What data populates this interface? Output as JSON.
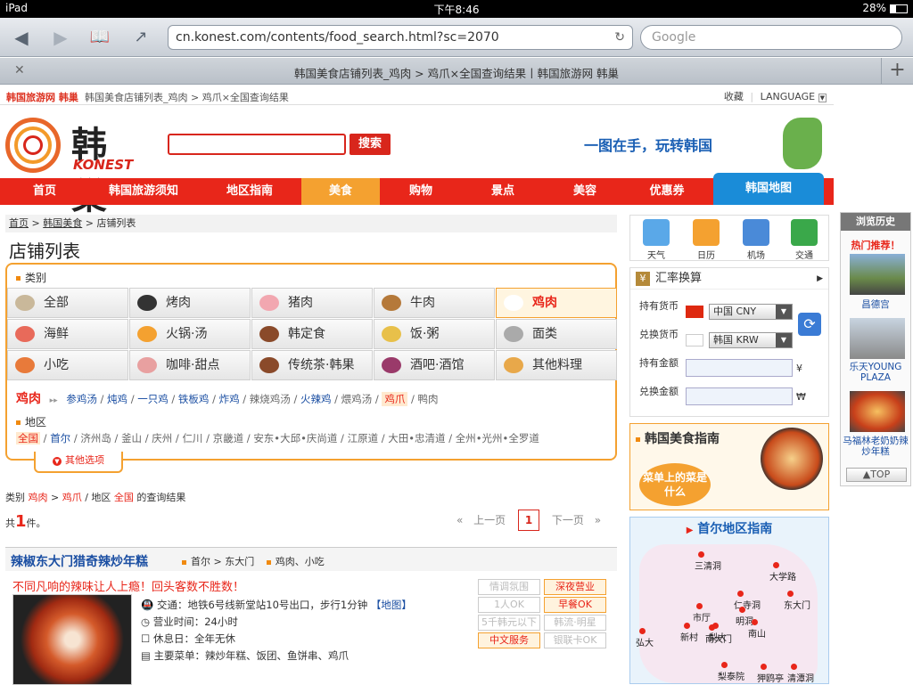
{
  "status": {
    "device": "iPad",
    "time": "下午8:46",
    "battery": "28%"
  },
  "browser": {
    "url": "cn.konest.com/contents/food_search.html?sc=2070",
    "search_placeholder": "Google",
    "tab_title": "韩国美食店铺列表_鸡肉 > 鸡爪×全国查询结果丨韩国旅游网 韩巢"
  },
  "topline": {
    "brand": "韩国旅游网 韩巢",
    "crumb": "韩国美食店铺列表_鸡肉 > 鸡爪×全国查询结果",
    "favorite": "收藏",
    "language": "LANGUAGE"
  },
  "logo": {
    "cn": "韩巢",
    "en": "KONEST"
  },
  "search": {
    "button": "搜索",
    "value": ""
  },
  "banner": {
    "text": "一图在手，玩转韩国"
  },
  "nav": [
    "首页",
    "韩国旅游须知",
    "地区指南",
    "美食",
    "购物",
    "景点",
    "美容",
    "优惠券",
    "韩国地图"
  ],
  "breadcrumb": {
    "home": "首页",
    "food": "韩国美食",
    "current": "店铺列表"
  },
  "page_title": "店铺列表",
  "category": {
    "label": "类别",
    "items": [
      {
        "label": "全部",
        "icon": "book-icon"
      },
      {
        "label": "烤肉",
        "icon": "grill-icon"
      },
      {
        "label": "猪肉",
        "icon": "pig-icon"
      },
      {
        "label": "牛肉",
        "icon": "cow-icon"
      },
      {
        "label": "鸡肉",
        "icon": "chicken-icon"
      },
      {
        "label": "海鲜",
        "icon": "crab-icon"
      },
      {
        "label": "火锅·汤",
        "icon": "hotpot-icon"
      },
      {
        "label": "韩定食",
        "icon": "set-meal-icon"
      },
      {
        "label": "饭·粥",
        "icon": "rice-icon"
      },
      {
        "label": "面类",
        "icon": "noodle-icon"
      },
      {
        "label": "小吃",
        "icon": "snack-icon"
      },
      {
        "label": "咖啡·甜点",
        "icon": "coffee-icon"
      },
      {
        "label": "传统茶·韩果",
        "icon": "tea-icon"
      },
      {
        "label": "酒吧·酒馆",
        "icon": "wine-icon"
      },
      {
        "label": "其他料理",
        "icon": "other-food-icon"
      }
    ],
    "sub_title": "鸡肉",
    "sub_items": [
      "参鸡汤",
      "炖鸡",
      "一只鸡",
      "铁板鸡",
      "炸鸡",
      "辣烧鸡汤",
      "火辣鸡",
      "煨鸡汤",
      "鸡爪",
      "鸭肉"
    ],
    "sub_links": [
      true,
      true,
      true,
      true,
      true,
      false,
      true,
      false,
      false,
      false
    ],
    "sub_selected": "鸡爪",
    "region_label": "地区",
    "regions": [
      "全国",
      "首尔",
      "济州岛",
      "釜山",
      "庆州",
      "仁川",
      "京畿道",
      "安东•大邱•庆尚道",
      "江原道",
      "大田•忠清道",
      "全州•光州•全罗道"
    ],
    "region_links": [
      false,
      true,
      false,
      false,
      false,
      false,
      false,
      false,
      false,
      false,
      false
    ],
    "more": "其他选项"
  },
  "result": {
    "p1": "类别",
    "cat": "鸡肉",
    "sub": "鸡爪",
    "p2": "地区",
    "region": "全国",
    "p3": "的查询结果"
  },
  "count": {
    "prefix": "共",
    "num": "1",
    "suffix": "件。"
  },
  "pager": {
    "prev": "上一页",
    "page": "1",
    "next": "下一页"
  },
  "shop": {
    "name": "辣椒东大门猎奇辣炒年糕",
    "location": "首尔 > 东大门",
    "type": "鸡肉、小吃",
    "promo": "不同凡响的辣味让人上瘾！回头客数不胜数！",
    "traffic": "交通：地铁6号线新堂站10号出口，步行1分钟",
    "map_link": "【地图】",
    "hours": "营业时间：24小时",
    "holiday": "休息日：全年无休",
    "menu": "主要菜单：辣炒年糕、饭团、鱼饼串、鸡爪",
    "tags": [
      {
        "label": "情调氛围",
        "on": false
      },
      {
        "label": "深夜营业",
        "on": true
      },
      {
        "label": "1人OK",
        "on": false
      },
      {
        "label": "早餐OK",
        "on": true
      },
      {
        "label": "5千韩元以下",
        "on": false
      },
      {
        "label": "韩流·明星",
        "on": false
      },
      {
        "label": "中文服务",
        "on": true
      },
      {
        "label": "银联卡OK",
        "on": false
      }
    ]
  },
  "right": {
    "icons": [
      "天气",
      "日历",
      "机场",
      "交通"
    ],
    "fx": {
      "title": "汇率换算",
      "hold": "持有货币",
      "hold_val": "中国 CNY",
      "exch": "兑换货币",
      "exch_val": "韩国 KRW",
      "hold_amt": "持有金额",
      "exch_amt": "兑换金额",
      "cny": "¥",
      "krw": "₩"
    },
    "guide": {
      "title": "韩国美食指南",
      "bubble": "菜单上的菜是什么"
    },
    "seoul": {
      "title": "首尔地区指南",
      "districts": [
        "三清洞",
        "大学路",
        "仁寺洞",
        "东大门",
        "市厅",
        "明洞",
        "南山",
        "弘大",
        "新村",
        "梨大",
        "南大门",
        "梨泰院",
        "狎鸥亭",
        "清潭洞"
      ]
    }
  },
  "history": {
    "title": "浏览历史",
    "hot": "热门推荐！",
    "items": [
      "昌德宫",
      "乐天YOUNG PLAZA",
      "马福林老奶奶辣炒年糕"
    ],
    "top": "▲TOP"
  },
  "colors": {
    "red": "#e8261a",
    "orange": "#f4a130",
    "blue": "#1a4ea2"
  }
}
